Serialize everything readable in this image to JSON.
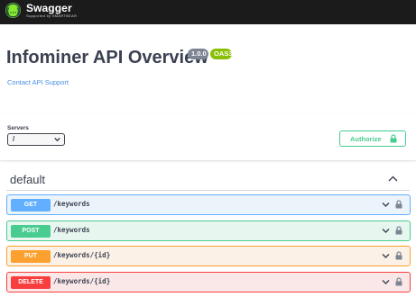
{
  "topbar": {
    "logo_title": "Swagger",
    "logo_subtitle": "Supported by SMARTBEAR"
  },
  "info": {
    "title": "Infominer API Overview",
    "version": "1.0.0",
    "oas": "OAS3",
    "contact_link": "Contact API Support"
  },
  "servers": {
    "label": "Servers",
    "selected": "/"
  },
  "authorize": {
    "label": "Authorize"
  },
  "tag": {
    "name": "default"
  },
  "operations": [
    {
      "method": "GET",
      "path": "/keywords",
      "color": "#61affe"
    },
    {
      "method": "POST",
      "path": "/keywords",
      "color": "#49cc90"
    },
    {
      "method": "PUT",
      "path": "/keywords/{id}",
      "color": "#fca130"
    },
    {
      "method": "DELETE",
      "path": "/keywords/{id}",
      "color": "#f93e3e"
    }
  ],
  "icons": {
    "logo": "swagger-logo-icon",
    "select_chevron": "chevron-down-icon",
    "tag_toggle": "chevron-up-icon",
    "op_expand": "chevron-down-icon",
    "lock": "lock-icon"
  },
  "colors": {
    "topbar": "#1b1b1b",
    "brand_green": "#85ea2d",
    "link": "#4990e2",
    "version_badge": "#7d8492",
    "oas_badge": "#89bf04"
  }
}
